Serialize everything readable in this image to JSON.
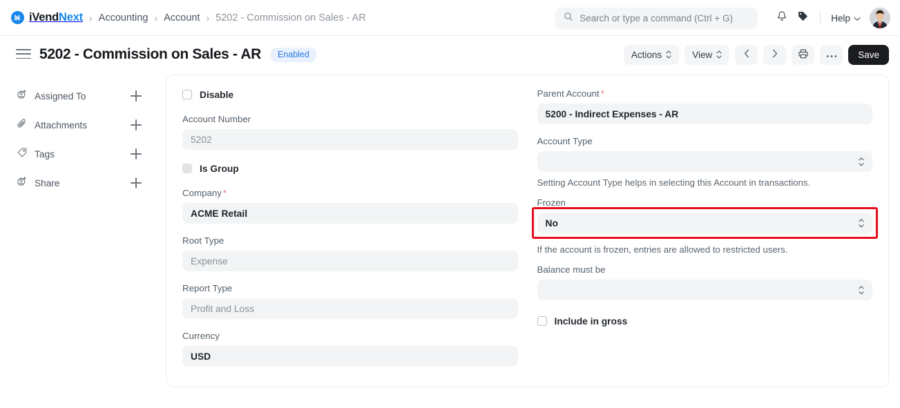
{
  "navbar": {
    "brand_primary": "iVend",
    "brand_secondary": "Next",
    "breadcrumbs": [
      {
        "label": "Accounting",
        "current": false
      },
      {
        "label": "Account",
        "current": false
      },
      {
        "label": "5202 - Commission on Sales - AR",
        "current": true
      }
    ],
    "separator": "›",
    "search": {
      "placeholder": "Search or type a command (Ctrl + G)",
      "value": "",
      "icon": "search-icon"
    },
    "notifications_icon": "bell-icon",
    "tags_icon": "tag-icon",
    "help_label": "Help",
    "help_chevron_icon": "chevron-down-icon",
    "avatar_icon": "user-avatar"
  },
  "titlebar": {
    "menu_icon": "hamburger-icon",
    "title": "5202 - Commission on Sales - AR",
    "status_badge": "Enabled",
    "actions_label": "Actions",
    "view_label": "View",
    "prev_icon": "chevron-left-icon",
    "next_icon": "chevron-right-icon",
    "print_icon": "printer-icon",
    "more_icon": "ellipsis-icon",
    "save_label": "Save"
  },
  "sidebar": {
    "items": [
      {
        "label": "Assigned To",
        "icon": "user-plus-icon",
        "add_icon": "plus-icon"
      },
      {
        "label": "Attachments",
        "icon": "paperclip-icon",
        "add_icon": "plus-icon"
      },
      {
        "label": "Tags",
        "icon": "tag-icon",
        "add_icon": "plus-icon"
      },
      {
        "label": "Share",
        "icon": "user-plus-icon",
        "add_icon": "plus-icon"
      }
    ]
  },
  "form": {
    "left": {
      "disable_checkbox": {
        "label": "Disable",
        "checked": false
      },
      "account_number": {
        "label": "Account Number",
        "value": "5202",
        "disabled": true
      },
      "is_group_checkbox": {
        "label": "Is Group",
        "checked": false,
        "disabled": true
      },
      "company": {
        "label": "Company",
        "value": "ACME Retail",
        "required": true
      },
      "root_type": {
        "label": "Root Type",
        "value": "Expense",
        "disabled": true
      },
      "report_type": {
        "label": "Report Type",
        "value": "Profit and Loss",
        "disabled": true
      },
      "currency": {
        "label": "Currency",
        "value": "USD"
      }
    },
    "right": {
      "parent_account": {
        "label": "Parent Account",
        "value": "5200 - Indirect Expenses - AR",
        "required": true
      },
      "account_type": {
        "label": "Account Type",
        "value": "",
        "hint": "Setting Account Type helps in selecting this Account in transactions."
      },
      "frozen": {
        "label": "Frozen",
        "value": "No",
        "hint": "If the account is frozen, entries are allowed to restricted users.",
        "highlighted": true
      },
      "balance_must_be": {
        "label": "Balance must be",
        "value": ""
      },
      "include_in_gross_checkbox": {
        "label": "Include in gross",
        "checked": false
      }
    }
  },
  "colors": {
    "brand_blue": "#1787ea",
    "badge_bg": "#e8f1fd",
    "badge_text": "#2b7ae0",
    "save_bg": "#1a1c1f",
    "field_bg": "#f3f4f5",
    "highlight_red": "#e60d1f",
    "required_asterisk": "#e8777c"
  }
}
